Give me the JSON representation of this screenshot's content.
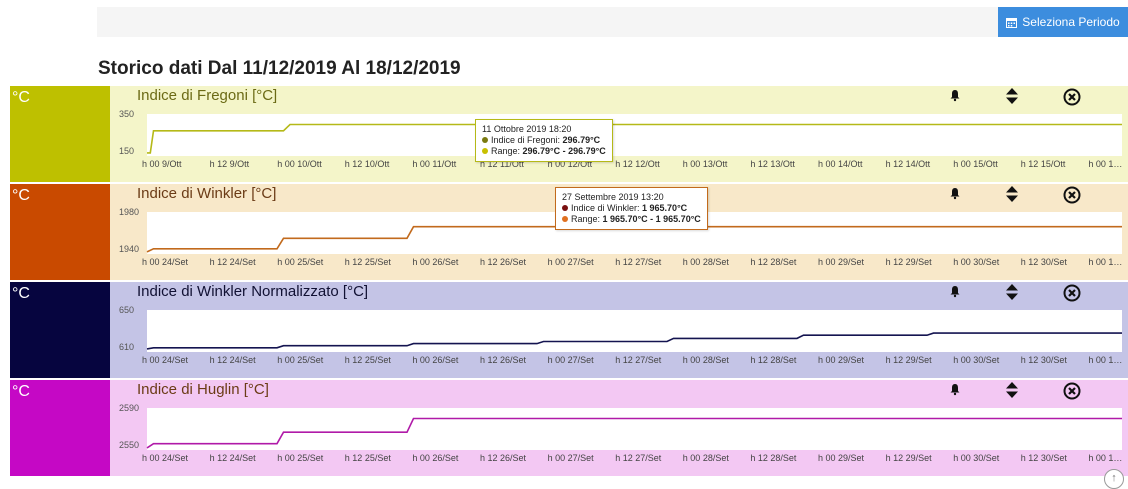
{
  "header": {
    "period_button": "Seleziona Periodo",
    "title": "Storico dati Dal 11/12/2019 Al 18/12/2019"
  },
  "icons": {
    "calendar": "calendar-icon",
    "bell": "bell-icon",
    "sort": "sort-icon",
    "close": "close-icon",
    "scroll_top": "arrow-up-icon"
  },
  "chart_data": [
    {
      "type": "line",
      "title": "Indice di Fregoni [°C]",
      "unit": "°C",
      "color": "#b5b918",
      "band_color": "#f4f5c9",
      "box_color": "#bec000",
      "title_color": "#6b6a15",
      "ylim": [
        150,
        350
      ],
      "x_ticks": [
        "h 00 9/Ott",
        "h 12 9/Ott",
        "h 00 10/Ott",
        "h 12 10/Ott",
        "h 00 11/Ott",
        "h 12 11/Ott",
        "h 00 12/Ott",
        "h 12 12/Ott",
        "h 00 13/Ott",
        "h 12 13/Ott",
        "h 00 14/Ott",
        "h 12 14/Ott",
        "h 00 15/Ott",
        "h 12 15/Ott",
        "h 00 1…"
      ],
      "series": [
        {
          "x": [
            0.0,
            0.05,
            0.1,
            2.1,
            2.2,
            15.0
          ],
          "values": [
            165,
            165,
            270,
            270,
            300,
            300
          ]
        }
      ],
      "tooltip": {
        "date": "11 Ottobre 2019 18:20",
        "rows": [
          {
            "label": "Indice di Fregoni: ",
            "value": "296.79°C",
            "color": "#7a7a10"
          },
          {
            "label": "Range: ",
            "value": "296.79°C - 296.79°C",
            "color": "#c8c000"
          }
        ]
      }
    },
    {
      "type": "line",
      "title": "Indice di Winkler [°C]",
      "unit": "°C",
      "color": "#c26a1c",
      "band_color": "#f8e8c9",
      "box_color": "#c94a00",
      "title_color": "#6b3b16",
      "ylim": [
        1940,
        1980
      ],
      "x_ticks": [
        "h 00 24/Set",
        "h 12 24/Set",
        "h 00 25/Set",
        "h 12 25/Set",
        "h 00 26/Set",
        "h 12 26/Set",
        "h 00 27/Set",
        "h 12 27/Set",
        "h 00 28/Set",
        "h 12 28/Set",
        "h 00 29/Set",
        "h 12 29/Set",
        "h 00 30/Set",
        "h 12 30/Set",
        "h 00 1…"
      ],
      "series": [
        {
          "x": [
            0.0,
            0.1,
            2.0,
            2.1,
            4.0,
            4.1,
            15.0
          ],
          "values": [
            1942,
            1945,
            1945,
            1955,
            1955,
            1966,
            1966
          ]
        }
      ],
      "tooltip": {
        "date": "27 Settembre 2019 13:20",
        "rows": [
          {
            "label": "Indice di Winkler: ",
            "value": "1 965.70°C",
            "color": "#7a1010"
          },
          {
            "label": "Range: ",
            "value": "1 965.70°C - 1 965.70°C",
            "color": "#e07020"
          }
        ]
      }
    },
    {
      "type": "line",
      "title": "Indice di Winkler Normalizzato [°C]",
      "unit": "°C",
      "color": "#141450",
      "band_color": "#c4c4e6",
      "box_color": "#06053f",
      "title_color": "#111133",
      "ylim": [
        610,
        650
      ],
      "x_ticks": [
        "h 00 24/Set",
        "h 12 24/Set",
        "h 00 25/Set",
        "h 12 25/Set",
        "h 00 26/Set",
        "h 12 26/Set",
        "h 00 27/Set",
        "h 12 27/Set",
        "h 00 28/Set",
        "h 12 28/Set",
        "h 00 29/Set",
        "h 12 29/Set",
        "h 00 30/Set",
        "h 12 30/Set",
        "h 00 1…"
      ],
      "series": [
        {
          "x": [
            0.0,
            0.1,
            2.0,
            2.1,
            4.0,
            4.1,
            6.0,
            6.1,
            8.0,
            8.1,
            10.0,
            10.1,
            12.0,
            12.1,
            15.0
          ],
          "values": [
            613,
            614,
            614,
            616,
            616,
            618,
            618,
            620,
            620,
            623,
            623,
            626,
            626,
            628,
            628
          ]
        }
      ]
    },
    {
      "type": "line",
      "title": "Indice di Huglin [°C]",
      "unit": "°C",
      "color": "#b01aa8",
      "band_color": "#f3c8f3",
      "box_color": "#c508c5",
      "title_color": "#6b3b16",
      "ylim": [
        2550,
        2590
      ],
      "x_ticks": [
        "h 00 24/Set",
        "h 12 24/Set",
        "h 00 25/Set",
        "h 12 25/Set",
        "h 00 26/Set",
        "h 12 26/Set",
        "h 00 27/Set",
        "h 12 27/Set",
        "h 00 28/Set",
        "h 12 28/Set",
        "h 00 29/Set",
        "h 12 29/Set",
        "h 00 30/Set",
        "h 12 30/Set",
        "h 00 1…"
      ],
      "series": [
        {
          "x": [
            0.0,
            0.1,
            2.0,
            2.1,
            4.0,
            4.1,
            15.0
          ],
          "values": [
            2552,
            2556,
            2556,
            2567,
            2567,
            2580,
            2580
          ]
        }
      ]
    }
  ]
}
